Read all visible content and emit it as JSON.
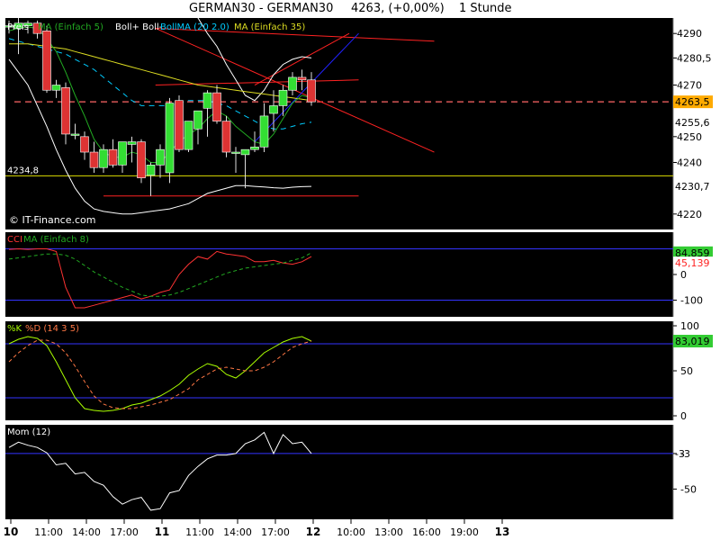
{
  "header": {
    "instrument": "GERMAN30 - GERMAN30",
    "quote": "4263, (+0,00%)",
    "interval": "1 Stunde"
  },
  "colors": {
    "background": "#000000",
    "frame": "#ffffff",
    "up_candle": "#33dd33",
    "down_candle": "#dd3333",
    "ma5": "#22aa22",
    "ma35": "#dddd22",
    "bollinger": "#ffffff",
    "bollinger_mid": "#00ccff",
    "resistance": "#ff2222",
    "trend_blue": "#2222ff",
    "support_yellow": "#dddd00",
    "cci": "#ff3333",
    "cci_ma": "#22aa22",
    "stoch_k": "#aaff00",
    "stoch_d": "#ff7744",
    "momentum": "#ffffff",
    "ref_line": "#3333ff",
    "badge_current": "#ffaa00",
    "badge_green": "#33cc33",
    "badge_red": "#ff3333"
  },
  "chart_data": [
    {
      "type": "candlestick",
      "panel": "price",
      "legend": [
        "Preis",
        "MA (Einfach 5)",
        "Boll+ Boll-",
        "BollMA (20 2.0)",
        "MA (Einfach 35)"
      ],
      "ylim": [
        4214,
        4296
      ],
      "yticks": [
        4220,
        4240,
        4250,
        4270,
        4280.5,
        4290
      ],
      "ytick_labels": [
        "4220",
        "4240",
        "4250",
        "4270",
        "4280,5",
        "4290"
      ],
      "badges": [
        {
          "label": "4263,5",
          "value": 4263.5,
          "kind": "current"
        },
        {
          "label": "4255,6",
          "value": 4255.6,
          "kind": "plain"
        },
        {
          "label": "4230,7",
          "value": 4230.7,
          "kind": "plain"
        }
      ],
      "left_level_label": "4234,8",
      "left_level": 4234.8,
      "watermark": "© IT-Finance.com",
      "x_index_range": [
        0,
        45
      ],
      "candles": [
        {
          "o": 4293,
          "h": 4295,
          "l": 4290,
          "c": 4293
        },
        {
          "o": 4292,
          "h": 4296,
          "l": 4282,
          "c": 4294
        },
        {
          "o": 4293,
          "h": 4295,
          "l": 4290,
          "c": 4294
        },
        {
          "o": 4294,
          "h": 4295,
          "l": 4288,
          "c": 4290
        },
        {
          "o": 4291,
          "h": 4293,
          "l": 4267,
          "c": 4268
        },
        {
          "o": 4268,
          "h": 4272,
          "l": 4265,
          "c": 4270
        },
        {
          "o": 4269,
          "h": 4271,
          "l": 4247,
          "c": 4251
        },
        {
          "o": 4251,
          "h": 4255,
          "l": 4249,
          "c": 4251
        },
        {
          "o": 4250,
          "h": 4252,
          "l": 4241,
          "c": 4244
        },
        {
          "o": 4244,
          "h": 4248,
          "l": 4236,
          "c": 4238
        },
        {
          "o": 4238,
          "h": 4247,
          "l": 4236,
          "c": 4245
        },
        {
          "o": 4245,
          "h": 4249,
          "l": 4238,
          "c": 4239
        },
        {
          "o": 4239,
          "h": 4248,
          "l": 4236,
          "c": 4248
        },
        {
          "o": 4247,
          "h": 4250,
          "l": 4240,
          "c": 4248
        },
        {
          "o": 4248,
          "h": 4249,
          "l": 4232,
          "c": 4234
        },
        {
          "o": 4235,
          "h": 4240,
          "l": 4227,
          "c": 4239
        },
        {
          "o": 4239,
          "h": 4247,
          "l": 4234,
          "c": 4245
        },
        {
          "o": 4236,
          "h": 4265,
          "l": 4232,
          "c": 4263
        },
        {
          "o": 4264,
          "h": 4266,
          "l": 4244,
          "c": 4245
        },
        {
          "o": 4245,
          "h": 4256,
          "l": 4244,
          "c": 4256
        },
        {
          "o": 4253,
          "h": 4258,
          "l": 4247,
          "c": 4260
        },
        {
          "o": 4261,
          "h": 4268,
          "l": 4250,
          "c": 4267
        },
        {
          "o": 4267,
          "h": 4270,
          "l": 4255,
          "c": 4256
        },
        {
          "o": 4256,
          "h": 4258,
          "l": 4242,
          "c": 4244
        },
        {
          "o": 4244,
          "h": 4246,
          "l": 4236,
          "c": 4244
        },
        {
          "o": 4243,
          "h": 4245,
          "l": 4230,
          "c": 4245
        },
        {
          "o": 4245,
          "h": 4252,
          "l": 4244,
          "c": 4246
        },
        {
          "o": 4246,
          "h": 4263,
          "l": 4244,
          "c": 4258
        },
        {
          "o": 4259,
          "h": 4268,
          "l": 4252,
          "c": 4262
        },
        {
          "o": 4262,
          "h": 4270,
          "l": 4258,
          "c": 4268
        },
        {
          "o": 4268,
          "h": 4275,
          "l": 4266,
          "c": 4273
        },
        {
          "o": 4273,
          "h": 4276,
          "l": 4268,
          "c": 4272
        },
        {
          "o": 4272,
          "h": 4275,
          "l": 4262,
          "c": 4263.5
        }
      ],
      "ma5": [
        4291,
        4292,
        4292.5,
        4292,
        4288,
        4283,
        4275,
        4266,
        4258,
        4249,
        4244,
        4242,
        4242,
        4244,
        4243,
        4240,
        4240,
        4244,
        4248,
        4251,
        4253,
        4257,
        4260,
        4258,
        4254,
        4251,
        4248,
        4247,
        4251,
        4257,
        4263,
        4266,
        4265
      ],
      "ma35": [
        4286,
        4286,
        4286,
        4285.5,
        4285,
        4284.5,
        4284,
        4283,
        4282,
        4281,
        4280,
        4279,
        4278,
        4277,
        4276,
        4275,
        4274,
        4273,
        4272,
        4271,
        4270,
        4269.5,
        4269,
        4268.5,
        4268,
        4267.5,
        4267,
        4266.5,
        4266,
        4265.5,
        4265,
        4264.5,
        4264
      ],
      "boll_upper": [
        4300,
        4300,
        4300,
        4300,
        4300,
        4300,
        4300,
        4300,
        4300,
        4300,
        4300,
        4300,
        4300,
        4300,
        4300,
        4300,
        4300,
        4300,
        4300,
        4300,
        4296,
        4290,
        4285,
        4278,
        4272,
        4266,
        4264,
        4268,
        4274,
        4278,
        4280,
        4281,
        4280.5
      ],
      "boll_lower": [
        4280,
        4275,
        4270,
        4262,
        4254,
        4245,
        4237,
        4230,
        4225,
        4222,
        4221,
        4220.5,
        4220,
        4220,
        4220.5,
        4221,
        4221.5,
        4222,
        4223,
        4224,
        4226,
        4228,
        4229,
        4230,
        4231,
        4231,
        4230.7,
        4230.5,
        4230.2,
        4230,
        4230.4,
        4230.6,
        4230.7
      ],
      "boll_mid": [
        4288,
        4287,
        4286,
        4285,
        4284,
        4283,
        4282,
        4280,
        4278,
        4276,
        4273,
        4270,
        4267,
        4264,
        4262,
        4262,
        4262,
        4262,
        4263,
        4264,
        4264,
        4264,
        4263,
        4262,
        4260,
        4258,
        4256,
        4254,
        4253,
        4253,
        4254,
        4255,
        4255.6
      ],
      "lines": [
        {
          "name": "resistance-upper",
          "color": "red",
          "p1": [
            15.5,
            4292
          ],
          "p2": [
            45,
            4287
          ]
        },
        {
          "name": "resistance-fan",
          "color": "red",
          "p1": [
            15.5,
            4292
          ],
          "p2": [
            45,
            4244
          ]
        },
        {
          "name": "channel-red",
          "color": "red",
          "p1": [
            26,
            4270
          ],
          "p2": [
            36,
            4290
          ]
        },
        {
          "name": "trend-blue",
          "color": "blue",
          "p1": [
            26,
            4248
          ],
          "p2": [
            37,
            4290
          ]
        },
        {
          "name": "horizontal-top",
          "color": "red",
          "p1": [
            15.5,
            4270
          ],
          "p2": [
            37,
            4272
          ]
        },
        {
          "name": "horizontal-bottom",
          "color": "red",
          "p1": [
            10,
            4227
          ],
          "p2": [
            37,
            4227
          ]
        }
      ]
    },
    {
      "type": "line",
      "panel": "cci",
      "legend": [
        "CCI",
        "MA (Einfach 8)"
      ],
      "ylim": [
        -165,
        165
      ],
      "ref_lines": [
        100,
        -100
      ],
      "ytick_labels": [
        "0",
        "-100"
      ],
      "yticks": [
        0,
        -100
      ],
      "badges": [
        {
          "label": "84,859",
          "value": 84.9,
          "kind": "green"
        },
        {
          "label": "45,139",
          "value": 45.1,
          "kind": "red"
        }
      ],
      "series": [
        {
          "name": "CCI",
          "values": [
            98,
            100,
            98,
            100,
            100,
            90,
            -50,
            -130,
            -130,
            -120,
            -110,
            -100,
            -90,
            -80,
            -95,
            -85,
            -70,
            -60,
            0,
            40,
            70,
            60,
            90,
            80,
            75,
            70,
            50,
            50,
            55,
            45,
            40,
            50,
            70
          ]
        },
        {
          "name": "MA (Einfach 8)",
          "values": [
            60,
            65,
            70,
            75,
            80,
            80,
            75,
            60,
            35,
            10,
            -10,
            -30,
            -50,
            -65,
            -80,
            -85,
            -85,
            -80,
            -70,
            -55,
            -40,
            -25,
            -10,
            5,
            15,
            25,
            30,
            35,
            40,
            45,
            55,
            65,
            85
          ]
        }
      ]
    },
    {
      "type": "line",
      "panel": "stochastic",
      "legend": [
        "%K",
        "%D (14 3 5)"
      ],
      "ylim": [
        -5,
        105
      ],
      "ref_lines": [
        80,
        20
      ],
      "yticks": [
        100,
        50,
        0
      ],
      "ytick_labels": [
        "100",
        "50",
        "0"
      ],
      "badges": [
        {
          "label": "83,019",
          "value": 83.0,
          "kind": "green"
        }
      ],
      "series": [
        {
          "name": "%K",
          "values": [
            80,
            85,
            88,
            86,
            78,
            60,
            40,
            20,
            8,
            6,
            5,
            6,
            8,
            12,
            14,
            18,
            22,
            28,
            35,
            45,
            52,
            58,
            55,
            46,
            42,
            50,
            60,
            70,
            76,
            82,
            86,
            88,
            83
          ]
        },
        {
          "name": "%D",
          "values": [
            60,
            70,
            78,
            84,
            84,
            80,
            70,
            55,
            38,
            22,
            13,
            9,
            8,
            8,
            10,
            12,
            15,
            18,
            24,
            30,
            40,
            46,
            52,
            54,
            52,
            50,
            50,
            54,
            60,
            68,
            76,
            80,
            83
          ]
        }
      ]
    },
    {
      "type": "line",
      "panel": "momentum",
      "legend": [
        "Mom (12)"
      ],
      "ylim": [
        -90,
        35
      ],
      "ref_lines": [
        -3
      ],
      "yticks": [
        -3,
        -50
      ],
      "ytick_labels": [
        "-3",
        "-50"
      ],
      "badges": [
        {
          "label": "-3",
          "value": -3,
          "kind": "plain"
        }
      ],
      "series": [
        {
          "name": "Mom (12)",
          "values": [
            5,
            12,
            8,
            5,
            -2,
            -18,
            -16,
            -30,
            -28,
            -40,
            -45,
            -60,
            -70,
            -64,
            -61,
            -78,
            -76,
            -55,
            -52,
            -32,
            -20,
            -10,
            -5,
            -5,
            -3,
            10,
            15,
            25,
            -3,
            22,
            10,
            12,
            -3
          ]
        }
      ]
    }
  ],
  "x_axis": {
    "labels": [
      "10",
      "11:00",
      "14:00",
      "17:00",
      "11",
      "11:00",
      "14:00",
      "17:00",
      "12",
      "10:00",
      "13:00",
      "16:00",
      "19:00",
      "13"
    ],
    "bold": [
      true,
      false,
      false,
      false,
      true,
      false,
      false,
      false,
      true,
      false,
      false,
      false,
      false,
      true
    ],
    "positions": [
      0,
      4,
      8,
      12,
      16,
      20,
      24,
      28,
      32,
      36,
      40,
      44,
      48,
      52
    ]
  }
}
